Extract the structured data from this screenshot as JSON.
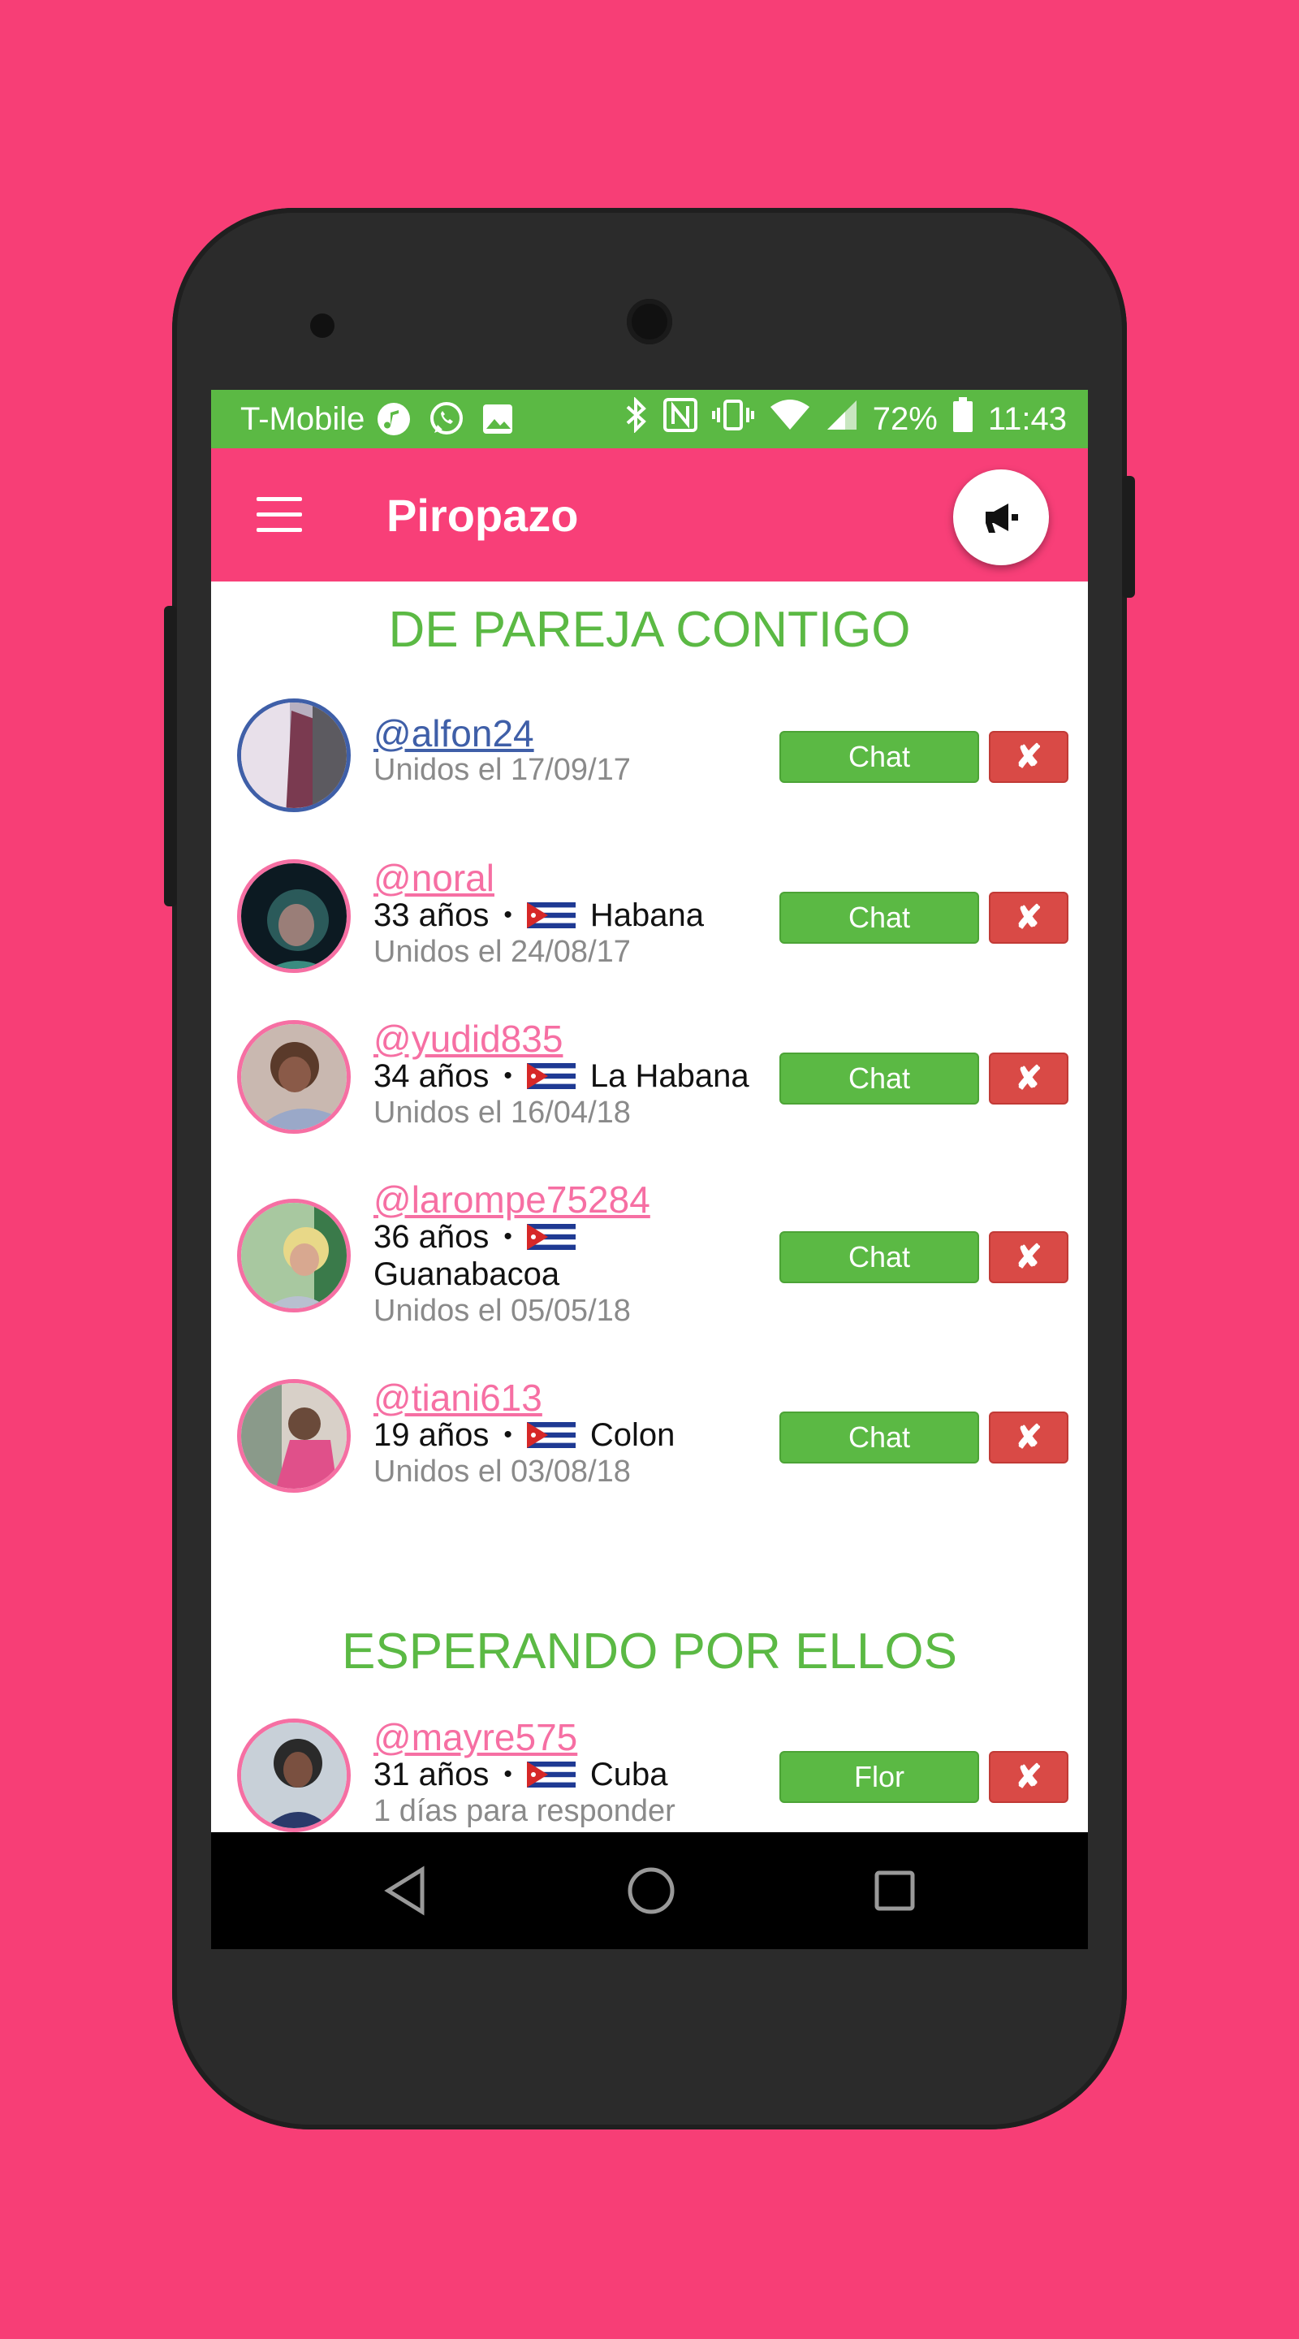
{
  "status_bar": {
    "carrier": "T-Mobile",
    "battery": "72%",
    "time": "11:43"
  },
  "app_bar": {
    "title": "Piropazo"
  },
  "sections": {
    "matched_title": "DE PAREJA CONTIGO",
    "waiting_title": "ESPERANDO POR ELLOS"
  },
  "matches": [
    {
      "username": "@alfon24",
      "joined": "Unidos el 17/09/17",
      "button": "Chat",
      "remove": "✘"
    },
    {
      "username": "@noral",
      "age": "33 años",
      "dot": "•",
      "city": "Habana",
      "joined": "Unidos el 24/08/17",
      "button": "Chat",
      "remove": "✘"
    },
    {
      "username": "@yudid835",
      "age": "34 años",
      "dot": "•",
      "city": "La Habana",
      "joined": "Unidos el 16/04/18",
      "button": "Chat",
      "remove": "✘"
    },
    {
      "username": "@larompe75284",
      "age": "36 años",
      "dot": "•",
      "city": "Guanabacoa",
      "joined": "Unidos el 05/05/18",
      "button": "Chat",
      "remove": "✘"
    },
    {
      "username": "@tiani613",
      "age": "19 años",
      "dot": "•",
      "city": "Colon",
      "joined": "Unidos el 03/08/18",
      "button": "Chat",
      "remove": "✘"
    }
  ],
  "waiting": [
    {
      "username": "@mayre575",
      "age": "31 años",
      "dot": "•",
      "city": "Cuba",
      "note": "1 días para responder",
      "button": "Flor",
      "remove": "✘"
    }
  ],
  "colors": {
    "background": "#f73e76",
    "app_bar": "#f83f78",
    "status_bar": "#5bb944",
    "accent_green": "#5bb944",
    "remove_red": "#d94a46",
    "username_pink": "#f66fa3"
  }
}
